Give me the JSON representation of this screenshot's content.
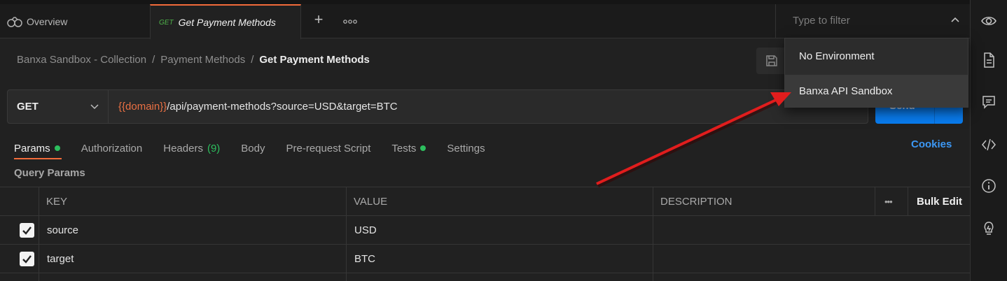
{
  "tabs": {
    "overview_label": "Overview",
    "active": {
      "method": "GET",
      "title": "Get Payment Methods"
    }
  },
  "environment": {
    "filter_placeholder": "Type to filter",
    "options": [
      "No Environment",
      "Banxa API Sandbox"
    ]
  },
  "breadcrumb": {
    "collection": "Banxa Sandbox - Collection",
    "separator": "/",
    "folder": "Payment Methods",
    "current": "Get Payment Methods"
  },
  "request": {
    "method": "GET",
    "url_variable": "{{domain}}",
    "url_rest": "/api/payment-methods?source=USD&target=BTC",
    "send_label": "Send"
  },
  "subtabs": {
    "params": "Params",
    "authorization": "Authorization",
    "headers": "Headers",
    "headers_count": "(9)",
    "body": "Body",
    "prerequest": "Pre-request Script",
    "tests": "Tests",
    "settings": "Settings",
    "cookies": "Cookies"
  },
  "query_params": {
    "title": "Query Params",
    "columns": {
      "key": "KEY",
      "value": "VALUE",
      "description": "DESCRIPTION",
      "more": "•••",
      "bulk_edit": "Bulk Edit"
    },
    "rows": [
      {
        "key": "source",
        "value": "USD",
        "checked": true
      },
      {
        "key": "target",
        "value": "BTC",
        "checked": true
      }
    ]
  },
  "colors": {
    "accent": "#f26b3a",
    "send": "#097bed",
    "active_dot": "#2dbf5e",
    "annotation_arrow": "#e11d1d"
  }
}
